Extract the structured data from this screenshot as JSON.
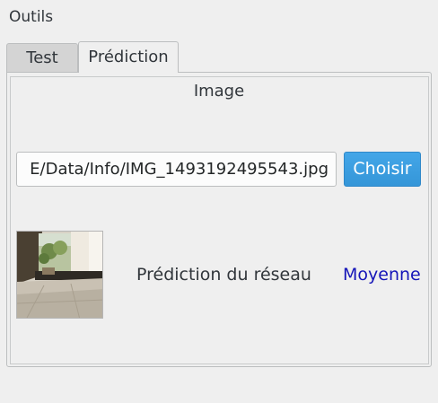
{
  "group": {
    "title": "Outils"
  },
  "tabs": [
    {
      "label": "Test",
      "active": false
    },
    {
      "label": "Prédiction",
      "active": true
    }
  ],
  "prediction_tab": {
    "image_title": "Image",
    "file_path": "E/Data/Info/IMG_1493192495543.jpg",
    "choose_label": "Choisir",
    "prediction_label": "Prédiction du réseau",
    "prediction_value": "Moyenne"
  },
  "colors": {
    "accent": "#3daee9",
    "prediction_value": "#1515b8"
  }
}
